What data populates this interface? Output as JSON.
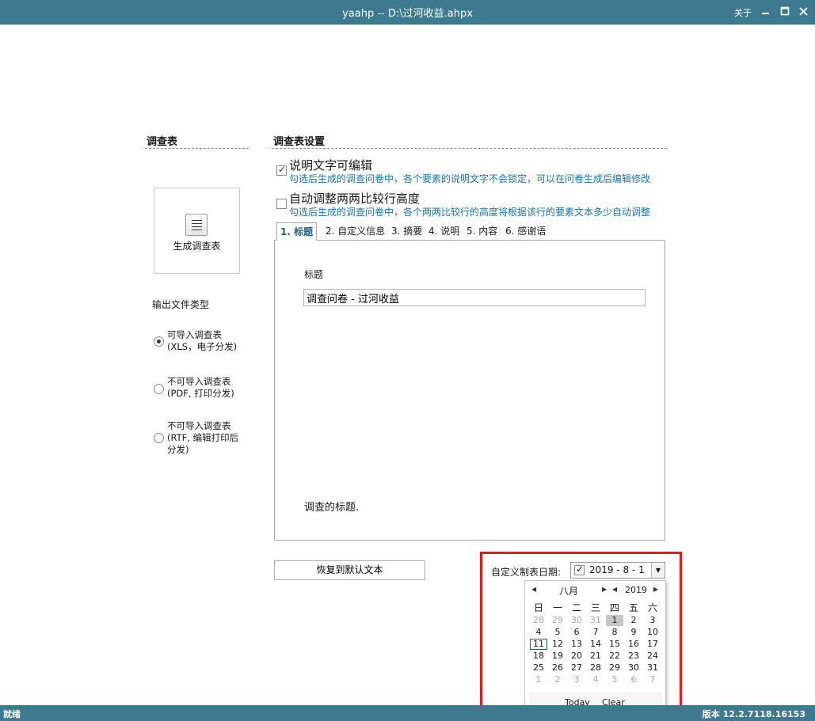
{
  "window": {
    "title": "yaahp  --  D:\\过河收益.ahpx",
    "about_label": "关于",
    "min_icon": "minimize-icon",
    "max_icon": "maximize-icon",
    "close_icon": "close-icon"
  },
  "left_panel": {
    "heading": "调查表",
    "generate_label": "生成调查表",
    "output_type_label": "输出文件类型",
    "options": [
      {
        "line1": "可导入调查表",
        "line2": "(XLS，电子分发)",
        "line3": "",
        "checked": true
      },
      {
        "line1": "不可导入调查表",
        "line2": "(PDF, 打印分发)",
        "line3": "",
        "checked": false
      },
      {
        "line1": "不可导入调查表",
        "line2": "(RTF, 编辑打印后",
        "line3": "分发)",
        "checked": false
      }
    ]
  },
  "settings": {
    "heading": "调查表设置",
    "option1": {
      "title": "说明文字可编辑",
      "desc": "勾选后生成的调查问卷中，各个要素的说明文字不会锁定，可以在问卷生成后编辑修改",
      "checked": true
    },
    "option2": {
      "title": "自动调整两两比较行高度",
      "desc": "勾选后生成的调查问卷中，各个两两比较行的高度将根据该行的要素文本多少自动调整",
      "checked": false
    },
    "tabs": [
      {
        "label": "1.  标题"
      },
      {
        "label": "2. 自定义信息"
      },
      {
        "label": "3. 摘要"
      },
      {
        "label": "4. 说明"
      },
      {
        "label": "5. 内容"
      },
      {
        "label": "6. 感谢语"
      }
    ],
    "field_label": "标题",
    "field_value": "调查问卷 - 过河收益",
    "hint": "调查的标题.",
    "restore_label": "恢复到默认文本"
  },
  "date_picker": {
    "label": "自定义制表日期:",
    "value": "2019  -  8  -  1",
    "checked": true,
    "month": "八月",
    "year": "2019",
    "weekdays": [
      "日",
      "一",
      "二",
      "三",
      "四",
      "五",
      "六"
    ],
    "weeks": [
      [
        "28",
        "29",
        "30",
        "31",
        "1",
        "2",
        "3"
      ],
      [
        "4",
        "5",
        "6",
        "7",
        "8",
        "9",
        "10"
      ],
      [
        "11",
        "12",
        "13",
        "14",
        "15",
        "16",
        "17"
      ],
      [
        "18",
        "19",
        "20",
        "21",
        "22",
        "23",
        "24"
      ],
      [
        "25",
        "26",
        "27",
        "28",
        "29",
        "30",
        "31"
      ],
      [
        "1",
        "2",
        "3",
        "4",
        "5",
        "6",
        "7"
      ]
    ],
    "today_label": "Today",
    "clear_label": "Clear"
  },
  "status": {
    "left": "就绪",
    "right": "版本 12.2.7118.16153"
  },
  "colors": {
    "accent": "#3d7a90",
    "link": "#1a76a8",
    "highlight_frame": "#e11a22"
  }
}
